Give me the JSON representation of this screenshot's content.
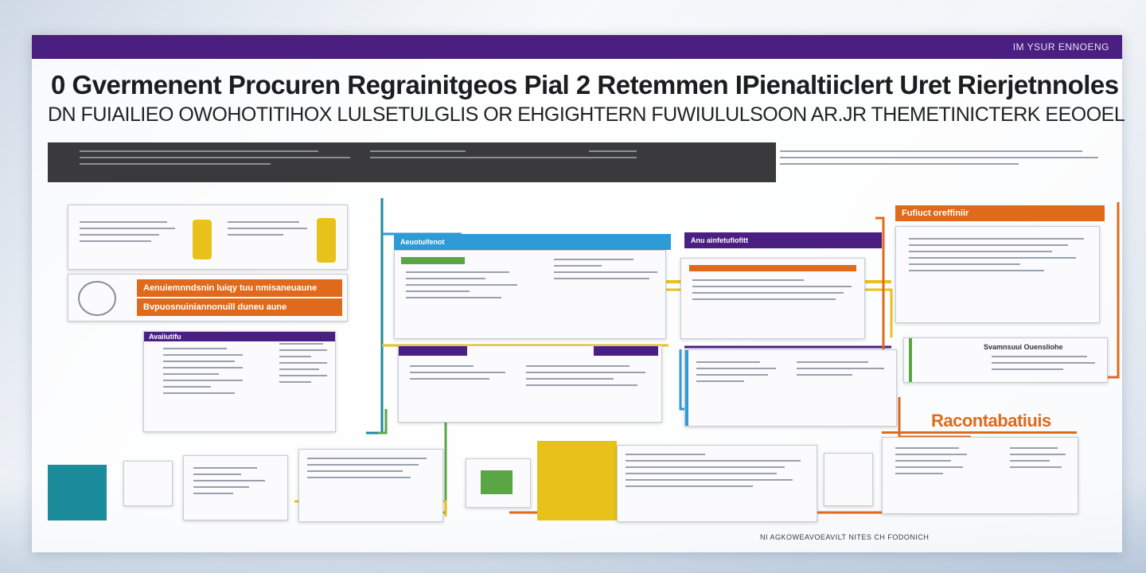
{
  "header": {
    "tag": "IM YSUR ENNOENG",
    "title": "0 Gvermenent Procuren Regrainitgeos Pial 2 Retemmen IPienaltiiclert Uret Rierjetnnoles",
    "subtitle": "DN FUIAILIEO OWOHOTITIHOX LULSETULGLIS OR EHGIGHTERN FUWIULULSOON AR.JR THEMETINICTERK EEOOEL"
  },
  "panels": {
    "top_right_title": "Fufiuct oreffiniir",
    "section_a_title": "Aeuotuifenot",
    "section_b_title": "Anu ainfetufiofitt",
    "purple_header": "Avaiiutifu",
    "right_mid_title": "Svamnsuui Ouensliohe",
    "big_orange_title": "Racontabatiuis",
    "orange_bar_1": "Aenuiemnndsnin luiqy tuu nmisaneuaune",
    "orange_bar_2": "Bvpuosnuiniannonuill duneu aune"
  },
  "footer": {
    "text": "NI AGKOWEAVOEAVILT NITES CH FODONICH"
  },
  "colors": {
    "purple": "#4b1f82",
    "orange": "#e06a1b",
    "yellow": "#e8c21a",
    "blue": "#2f9bd6",
    "teal": "#1c8b9b",
    "green": "#5aa645",
    "red": "#d7452b"
  }
}
